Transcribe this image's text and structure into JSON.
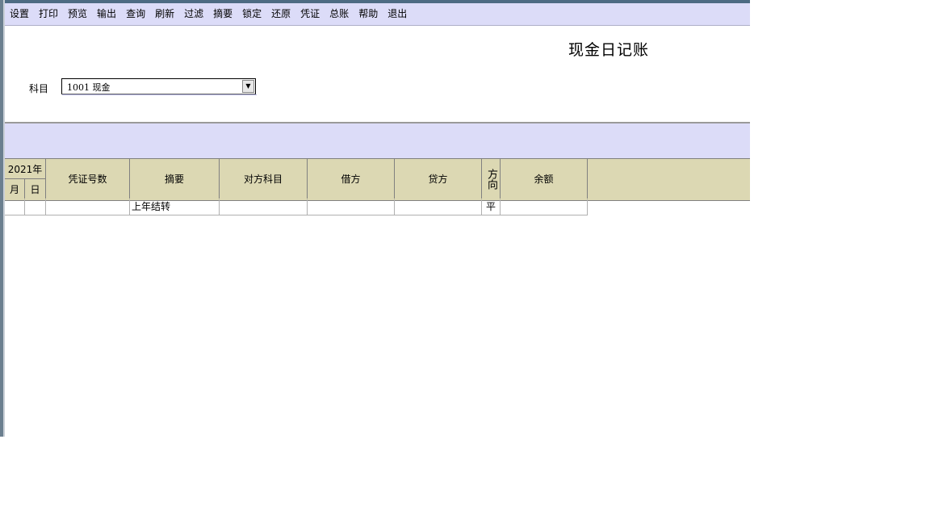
{
  "menu": [
    "设置",
    "打印",
    "预览",
    "输出",
    "查询",
    "刷新",
    "过滤",
    "摘要",
    "锁定",
    "还原",
    "凭证",
    "总账",
    "帮助",
    "退出"
  ],
  "title": "现金日记账",
  "subject": {
    "label": "科目",
    "value": "1001 现金"
  },
  "table": {
    "year": "2021年",
    "month": "月",
    "day": "日",
    "voucher": "凭证号数",
    "summary": "摘要",
    "counter_account": "对方科目",
    "debit": "借方",
    "credit": "贷方",
    "direction": "方向",
    "balance": "余额"
  },
  "rows": [
    {
      "month": "",
      "day": "",
      "voucher": "",
      "summary": "上年结转",
      "counter_account": "",
      "debit": "",
      "credit": "",
      "direction": "平",
      "balance": ""
    }
  ]
}
